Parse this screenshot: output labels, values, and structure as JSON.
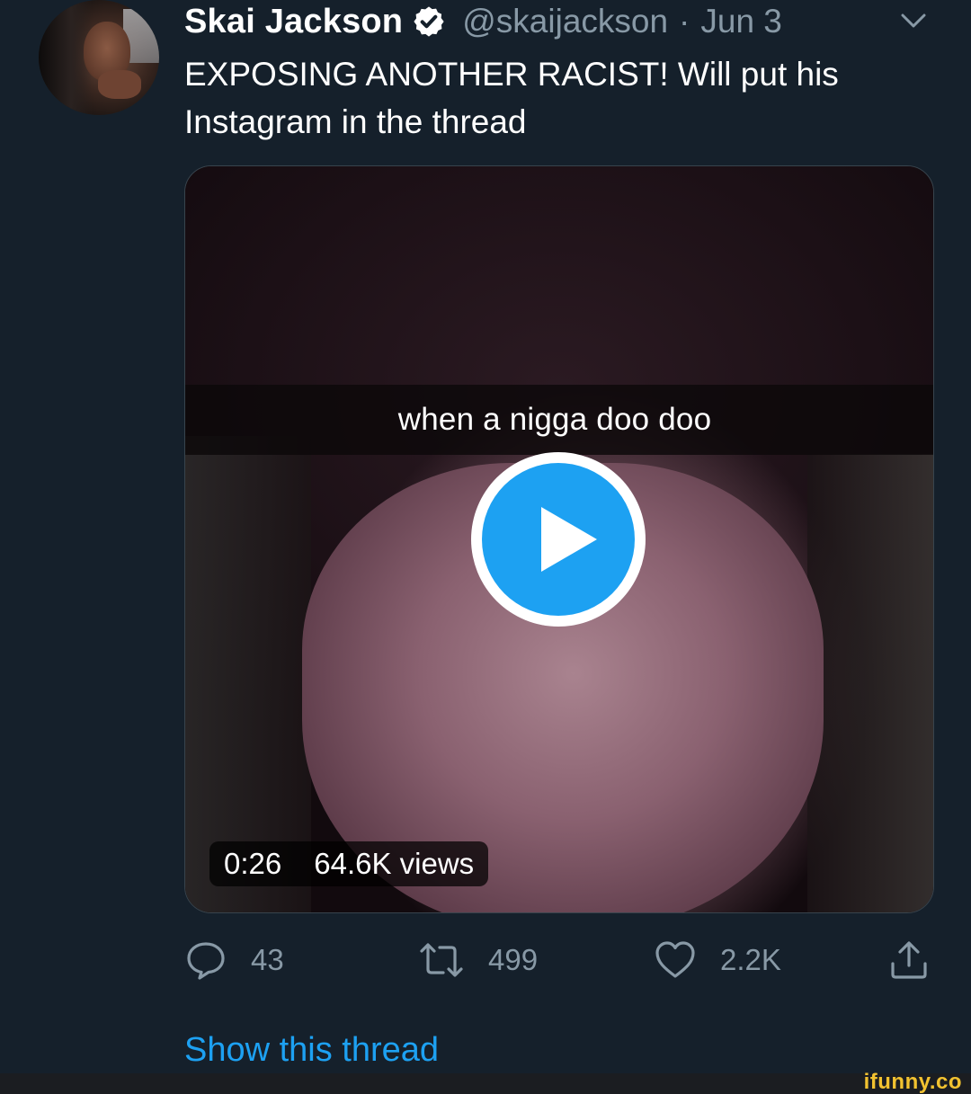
{
  "tweet": {
    "author": {
      "display_name": "Skai Jackson",
      "handle": "@skaijackson",
      "verified": true
    },
    "separator": "·",
    "date": "Jun 3",
    "text": "EXPOSING ANOTHER RACIST! Will put his Instagram in the thread",
    "media": {
      "caption": "when a nigga doo doo",
      "duration": "0:26",
      "views": "64.6K views"
    },
    "actions": {
      "replies": "43",
      "retweets": "499",
      "likes": "2.2K"
    },
    "show_thread_label": "Show this thread"
  },
  "watermark": {
    "text": "ifunny.co"
  },
  "colors": {
    "background": "#15202b",
    "secondary_text": "#8899a6",
    "accent": "#1da1f2",
    "watermark": "#f2c230"
  },
  "icons": {
    "verified": "verified-badge-icon",
    "caret": "chevron-down-icon",
    "reply": "reply-icon",
    "retweet": "retweet-icon",
    "like": "heart-icon",
    "share": "share-icon",
    "play": "play-icon"
  }
}
